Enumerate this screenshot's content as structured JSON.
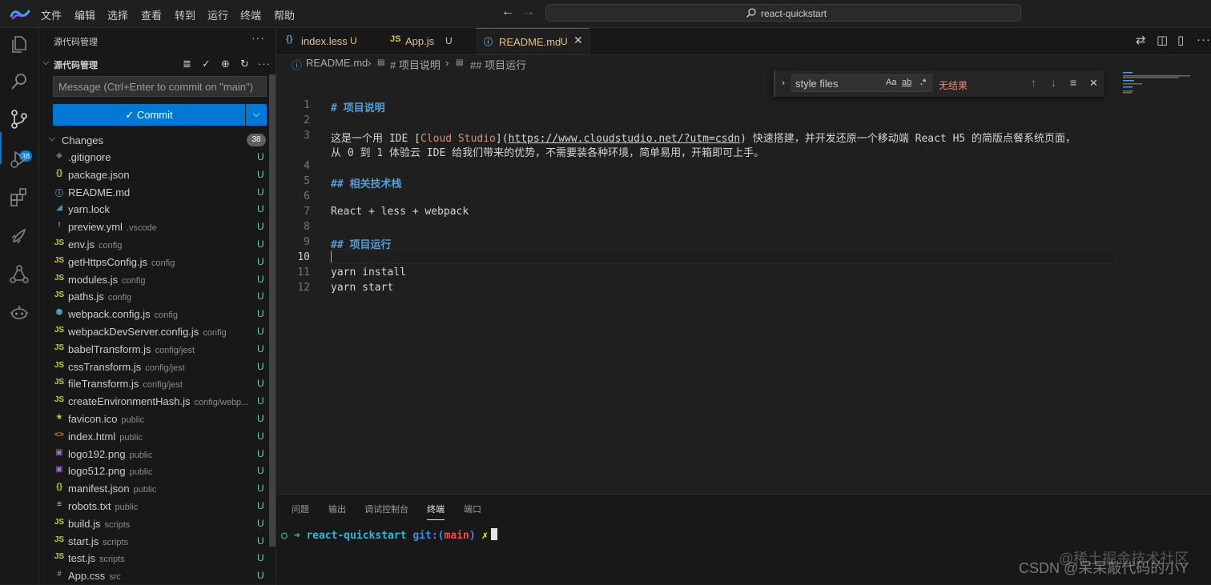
{
  "menu": [
    "文件",
    "编辑",
    "选择",
    "查看",
    "转到",
    "运行",
    "终端",
    "帮助"
  ],
  "command_center": "react-quickstart",
  "activity": {
    "scm_badge": "38"
  },
  "sidebar": {
    "title": "源代码管理",
    "repo_title": "源代码管理",
    "commit_placeholder": "Message (Ctrl+Enter to commit on \"main\")",
    "commit_label": "Commit",
    "changes_label": "Changes",
    "changes_count": "38",
    "files": [
      {
        "name": ".gitignore",
        "dir": "",
        "status": "U",
        "icon": "◆",
        "color": "#6d6d6d"
      },
      {
        "name": "package.json",
        "dir": "",
        "status": "U",
        "icon": "{}",
        "color": "#cbcb41"
      },
      {
        "name": "README.md",
        "dir": "",
        "status": "U",
        "icon": "ⓘ",
        "color": "#519aba"
      },
      {
        "name": "yarn.lock",
        "dir": "",
        "status": "U",
        "icon": "◢",
        "color": "#519aba"
      },
      {
        "name": "preview.yml",
        "dir": ".vscode",
        "status": "U",
        "icon": "!",
        "color": "#a074c4"
      },
      {
        "name": "env.js",
        "dir": "config",
        "status": "U",
        "icon": "JS",
        "color": "#cbcb41"
      },
      {
        "name": "getHttpsConfig.js",
        "dir": "config",
        "status": "U",
        "icon": "JS",
        "color": "#cbcb41"
      },
      {
        "name": "modules.js",
        "dir": "config",
        "status": "U",
        "icon": "JS",
        "color": "#cbcb41"
      },
      {
        "name": "paths.js",
        "dir": "config",
        "status": "U",
        "icon": "JS",
        "color": "#cbcb41"
      },
      {
        "name": "webpack.config.js",
        "dir": "config",
        "status": "U",
        "icon": "⬢",
        "color": "#519aba"
      },
      {
        "name": "webpackDevServer.config.js",
        "dir": "config",
        "status": "U",
        "icon": "JS",
        "color": "#cbcb41"
      },
      {
        "name": "babelTransform.js",
        "dir": "config/jest",
        "status": "U",
        "icon": "JS",
        "color": "#cbcb41"
      },
      {
        "name": "cssTransform.js",
        "dir": "config/jest",
        "status": "U",
        "icon": "JS",
        "color": "#cbcb41"
      },
      {
        "name": "fileTransform.js",
        "dir": "config/jest",
        "status": "U",
        "icon": "JS",
        "color": "#cbcb41"
      },
      {
        "name": "createEnvironmentHash.js",
        "dir": "config/webp...",
        "status": "U",
        "icon": "JS",
        "color": "#cbcb41"
      },
      {
        "name": "favicon.ico",
        "dir": "public",
        "status": "U",
        "icon": "★",
        "color": "#cbcb41"
      },
      {
        "name": "index.html",
        "dir": "public",
        "status": "U",
        "icon": "<>",
        "color": "#e37933"
      },
      {
        "name": "logo192.png",
        "dir": "public",
        "status": "U",
        "icon": "▣",
        "color": "#a074c4"
      },
      {
        "name": "logo512.png",
        "dir": "public",
        "status": "U",
        "icon": "▣",
        "color": "#a074c4"
      },
      {
        "name": "manifest.json",
        "dir": "public",
        "status": "U",
        "icon": "{}",
        "color": "#cbcb41"
      },
      {
        "name": "robots.txt",
        "dir": "public",
        "status": "U",
        "icon": "≡",
        "color": "#cccccc"
      },
      {
        "name": "build.js",
        "dir": "scripts",
        "status": "U",
        "icon": "JS",
        "color": "#cbcb41"
      },
      {
        "name": "start.js",
        "dir": "scripts",
        "status": "U",
        "icon": "JS",
        "color": "#cbcb41"
      },
      {
        "name": "test.js",
        "dir": "scripts",
        "status": "U",
        "icon": "JS",
        "color": "#cbcb41"
      },
      {
        "name": "App.css",
        "dir": "src",
        "status": "U",
        "icon": "#",
        "color": "#519aba"
      }
    ]
  },
  "tabs": [
    {
      "icon": "{}",
      "icon_color": "#519aba",
      "label": "index.less",
      "status": "U"
    },
    {
      "icon": "JS",
      "icon_color": "#cbcb41",
      "label": "App.js",
      "status": "U"
    },
    {
      "icon": "ⓘ",
      "icon_color": "#519aba",
      "label": "README.md",
      "status": "U"
    }
  ],
  "breadcrumb": [
    "README.md",
    "# 项目说明",
    "## 项目运行"
  ],
  "editor": {
    "line_numbers": [
      "1",
      "2",
      "3",
      "",
      "4",
      "5",
      "6",
      "7",
      "8",
      "9",
      "10",
      "11",
      "12"
    ],
    "lines": {
      "l1": "# 项目说明",
      "l3a_pre": "这是一个用 IDE [",
      "l3a_link": "Cloud Studio",
      "l3a_mid": "](",
      "l3a_url": "https://www.cloudstudio.net/?utm=csdn",
      "l3a_post": ") 快速搭建，并开发还原一个移动端 React H5 的简版点餐系统页面，",
      "l3b": "从 0 到 1 体验云 IDE 给我们带来的优势，不需要装各种环境，简单易用，开箱即可上手。",
      "l5": "## 相关技术栈",
      "l7": "React + less + webpack",
      "l9": "## 项目运行",
      "l11": "yarn install",
      "l12": "yarn start"
    }
  },
  "find": {
    "value": "style files",
    "opt_case": "Aa",
    "opt_word": "ab",
    "opt_regex": ".*",
    "result": "无结果"
  },
  "panel": {
    "tabs": [
      "问题",
      "输出",
      "调试控制台",
      "终端",
      "端口"
    ],
    "terminal": {
      "prompt": "○ ➜",
      "dir": "react-quickstart",
      "git_label": "git:(",
      "branch": "main",
      "git_close": ")",
      "mark": "✗"
    }
  },
  "watermark": {
    "line1": "@稀土掘金技术社区",
    "line2": "CSDN @呆呆敲代码的小Y"
  },
  "colors": {
    "accent": "#0078d4",
    "untracked": "#73c991",
    "heading": "#569cd6",
    "link": "#ce9178"
  }
}
